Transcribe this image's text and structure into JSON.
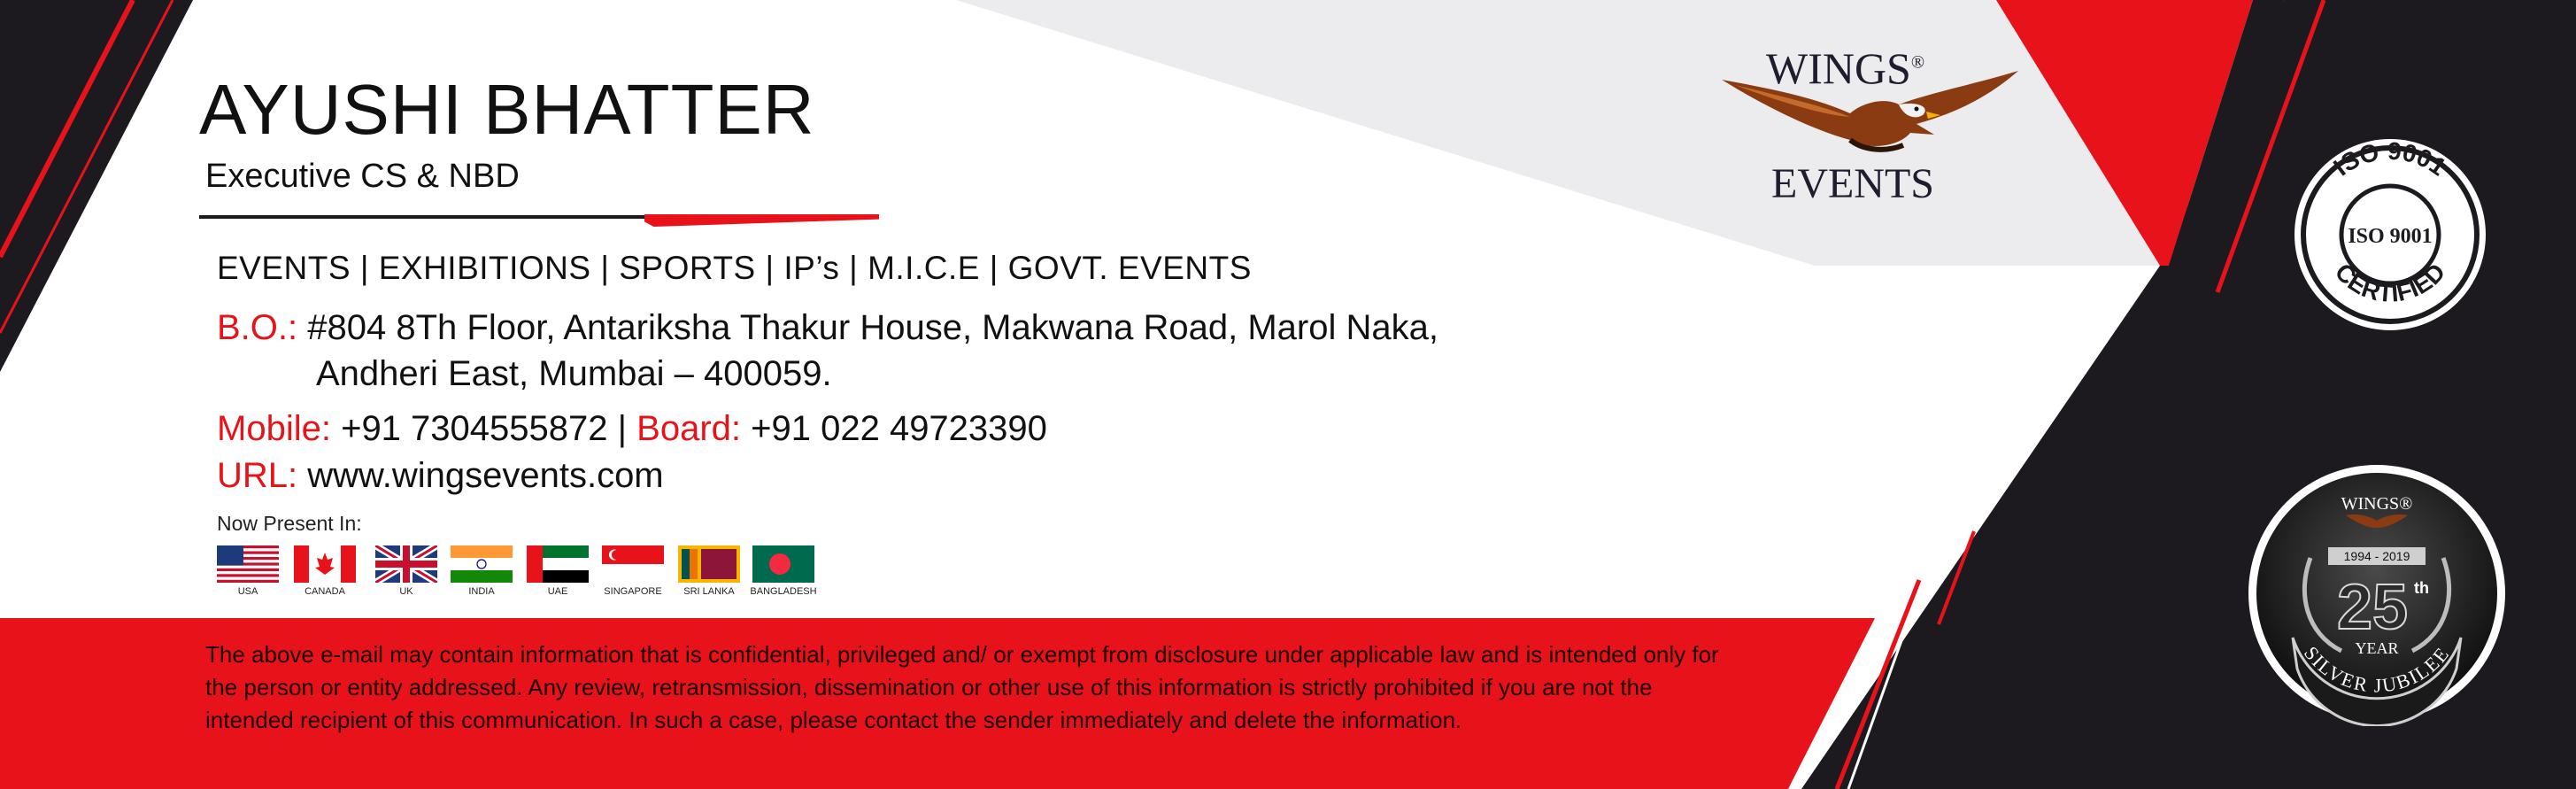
{
  "card": {
    "name": "AYUSHI BHATTER",
    "designation": "Executive CS & NBD",
    "services": "EVENTS | EXHIBITIONS | SPORTS | IP’s | M.I.C.E | GOVT. EVENTS",
    "address_label": "B.O.:",
    "address_line1": "#804 8Th Floor, Antariksha Thakur House, Makwana Road, Marol Naka,",
    "address_line2": "Andheri East, Mumbai – 400059.",
    "mobile_label": "Mobile:",
    "mobile_value": "+91 7304555872 |",
    "board_label": "Board:",
    "board_value": "+91 022 49723390",
    "url_label": "URL:",
    "url_value": "www.wingsevents.com",
    "present_in": "Now Present In:",
    "countries": [
      "USA",
      "CANADA",
      "UK",
      "INDIA",
      "UAE",
      "SINGAPORE",
      "SRI LANKA",
      "BANGLADESH"
    ],
    "disclaimer": "The above e-mail may contain information that is confidential, privileged and/ or exempt from disclosure under applicable law and is intended only for the person or entity addressed. Any review, retransmission, dissemination or other use of this information is strictly prohibited if you are not the intended recipient of this communication. In such a case, please contact the sender immediately and delete the information."
  },
  "logo": {
    "title": "WINGS",
    "registered": "®",
    "subtitle": "EVENTS"
  },
  "iso_badge": {
    "arc_top": "ISO 9001",
    "center": "ISO 9001",
    "arc_bottom": "CERTIFIED"
  },
  "jubilee_badge": {
    "brand": "WINGS®",
    "years": "1994 - 2019",
    "number": "25",
    "suffix": "th",
    "year_word": "YEAR",
    "ribbon": "SILVER JUBILEE"
  },
  "colors": {
    "accent_red": "#e8131a",
    "dark": "#1c1a1f",
    "light_gray": "#ececee"
  }
}
